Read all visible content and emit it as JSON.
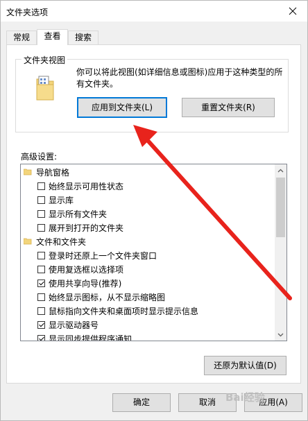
{
  "window": {
    "title": "文件夹选项"
  },
  "tabs": [
    {
      "label": "常规",
      "active": false
    },
    {
      "label": "查看",
      "active": true
    },
    {
      "label": "搜索",
      "active": false
    }
  ],
  "folder_views": {
    "title": "文件夹视图",
    "description_line1": "你可以将此视图(如详细信息或图标)应用于这种类型的所",
    "description_line2": "有文件夹。",
    "apply_button": "应用到文件夹(L)",
    "reset_button": "重置文件夹(R)"
  },
  "advanced": {
    "label": "高级设置:",
    "items": [
      {
        "type": "category",
        "label": "导航窗格",
        "icon": "folder-icon"
      },
      {
        "type": "checkbox",
        "label": "始终显示可用性状态",
        "checked": false
      },
      {
        "type": "checkbox",
        "label": "显示库",
        "checked": false
      },
      {
        "type": "checkbox",
        "label": "显示所有文件夹",
        "checked": false
      },
      {
        "type": "checkbox",
        "label": "展开到打开的文件夹",
        "checked": false
      },
      {
        "type": "category",
        "label": "文件和文件夹",
        "icon": "folder-icon"
      },
      {
        "type": "checkbox",
        "label": "登录时还原上一个文件夹窗口",
        "checked": false
      },
      {
        "type": "checkbox",
        "label": "使用复选框以选择项",
        "checked": false
      },
      {
        "type": "checkbox",
        "label": "使用共享向导(推荐)",
        "checked": true
      },
      {
        "type": "checkbox",
        "label": "始终显示图标，从不显示缩略图",
        "checked": false
      },
      {
        "type": "checkbox",
        "label": "鼠标指向文件夹和桌面项时显示提示信息",
        "checked": false
      },
      {
        "type": "checkbox",
        "label": "显示驱动器号",
        "checked": true
      },
      {
        "type": "checkbox",
        "label": "显示同步提供程序通知",
        "checked": true
      }
    ],
    "restore_defaults": "还原为默认值(D)"
  },
  "footer": {
    "ok": "确定",
    "cancel": "取消",
    "apply": "应用(A)"
  },
  "watermark": "Bai经验",
  "colors": {
    "arrow": "#e8231c",
    "default_button_border": "#0078d7",
    "scroll_thumb": "#cdcdcd"
  }
}
